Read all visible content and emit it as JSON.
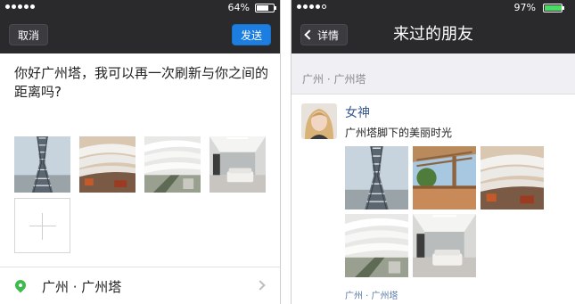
{
  "left_phone": {
    "status": {
      "battery_percent": "64%",
      "battery_level": 0.64
    },
    "nav": {
      "cancel_label": "取消",
      "send_label": "发送"
    },
    "post_text": "你好广州塔，我可以再一次刷新与你之间的距离吗?",
    "photos": [
      "tower-photo",
      "building-photo",
      "interior-photo",
      "lobby-photo"
    ],
    "add_photo_icon": "plus-icon",
    "location": {
      "icon": "location-pin-icon",
      "text": "广州 · 广州塔"
    }
  },
  "right_phone": {
    "status": {
      "battery_percent": "97%",
      "battery_level": 0.97
    },
    "nav": {
      "back_label": "详情",
      "title": "来过的朋友"
    },
    "section_label": "广州 · 广州塔",
    "post": {
      "user_name": "女神",
      "caption": "广州塔脚下的美丽时光",
      "photos": [
        "tower-photo",
        "terrace-photo",
        "building-photo",
        "interior-photo",
        "lobby-photo"
      ],
      "location": "广州 · 广州塔"
    }
  },
  "colors": {
    "nav_bg": "#2a2a2d",
    "send_blue": "#1c7ee0",
    "link_blue": "#3b5a8f",
    "pin_green": "#3dbb4c"
  }
}
